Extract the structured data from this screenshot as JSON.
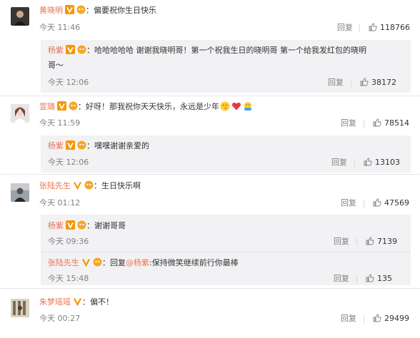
{
  "colors": {
    "username": "#eb7350",
    "meta": "#808080",
    "sub_bg": "#f2f2f5"
  },
  "icons": {
    "verified": "verified-v-icon",
    "level": "level-badge-icon",
    "like": "thumb-up-icon"
  },
  "ui": {
    "reply_label": "回复"
  },
  "comments": [
    {
      "user": "黄晓明",
      "text": "：偏要祝你生日快乐",
      "time": "今天 11:46",
      "likes": "118766",
      "replies": [
        {
          "user": "杨紫",
          "text": "：哈哈哈哈哈 谢谢我晓明哥！第一个祝我生日的晓明哥 第一个给我发红包的晓明",
          "text2": "哥～",
          "time": "今天 12:06",
          "likes": "38172"
        }
      ]
    },
    {
      "user": "宣璐",
      "text": "：好呀！那我祝你天天快乐，永远是少年",
      "time": "今天 11:59",
      "likes": "78514",
      "replies": [
        {
          "user": "杨紫",
          "text": "：嘿嘿谢谢亲爱的",
          "time": "今天 12:06",
          "likes": "13103"
        }
      ]
    },
    {
      "user": "张陆先生",
      "text": "：生日快乐啊",
      "time": "今天 01:12",
      "likes": "47569",
      "replies": [
        {
          "user": "杨紫",
          "text": "：谢谢哥哥",
          "time": "今天 09:36",
          "likes": "7139"
        },
        {
          "user": "张陆先生",
          "text_prefix": "：回复",
          "mention": "@杨紫",
          "text": ":保持微笑继续前行你最棒",
          "time": "今天 15:48",
          "likes": "135"
        }
      ]
    },
    {
      "user": "朱梦瑶瑶",
      "text": "：偏不！",
      "time": "今天 00:27",
      "likes": "29499"
    }
  ]
}
